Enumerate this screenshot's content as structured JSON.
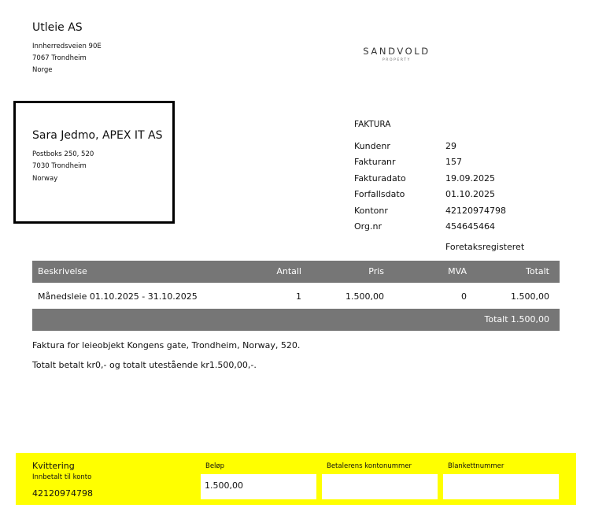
{
  "sender": {
    "name": "Utleie AS",
    "address_lines": [
      "Innherredsveien 90E",
      "7067 Trondheim",
      "Norge"
    ]
  },
  "logo": {
    "text": "SANDVOLD",
    "subtext": "PROPERTY"
  },
  "recipient": {
    "name": "Sara Jedmo, APEX IT AS",
    "address_lines": [
      "Postboks 250, 520",
      "7030 Trondheim",
      "Norway"
    ]
  },
  "invoice": {
    "type": "FAKTURA",
    "fields": [
      {
        "label": "Kundenr",
        "value": "29"
      },
      {
        "label": "Fakturanr",
        "value": "157"
      },
      {
        "label": "Fakturadato",
        "value": "19.09.2025"
      },
      {
        "label": "Forfallsdato",
        "value": "01.10.2025"
      },
      {
        "label": "Kontonr",
        "value": "42120974798"
      },
      {
        "label": "Org.nr",
        "value": "454645464"
      }
    ],
    "register_note": "Foretaksregisteret"
  },
  "table": {
    "headers": [
      "Beskrivelse",
      "Antall",
      "Pris",
      "MVA",
      "Totalt"
    ],
    "rows": [
      [
        "Månedsleie 01.10.2025 - 31.10.2025",
        "1",
        "1.500,00",
        "0",
        "1.500,00"
      ]
    ],
    "total": "Totalt 1.500,00"
  },
  "notes": [
    "Faktura for leieobjekt Kongens gate, Trondheim, Norway, 520.",
    "Totalt betalt kr0,- og totalt utestående kr1.500,00,-."
  ],
  "receipt": {
    "title": "Kvittering",
    "subtitle": "Innbetalt til konto",
    "account": "42120974798",
    "amount_label": "Beløp",
    "amount_value": "1.500,00",
    "payer_account_label": "Betalerens kontonummer",
    "payer_account_value": "",
    "form_number_label": "Blankettnummer",
    "form_number_value": ""
  },
  "colors": {
    "header_bar": "#767676",
    "receipt_bg": "#ffff00",
    "box_border": "#000000"
  }
}
